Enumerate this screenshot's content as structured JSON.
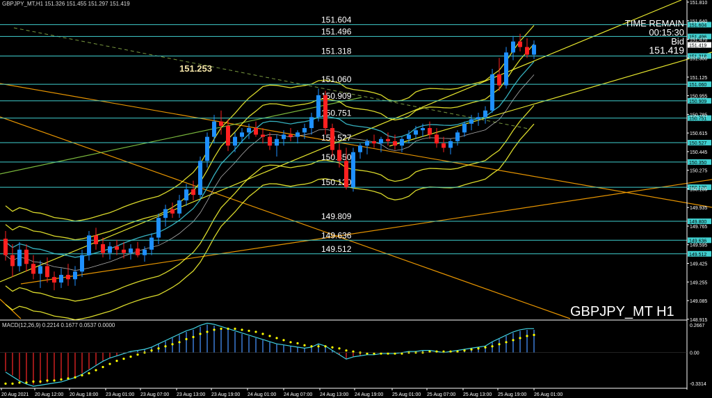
{
  "header": {
    "symbol_info": "GBPJPY_MT,H1  151.326 151.455 151.297 151.419"
  },
  "info_panel": {
    "time_remain_label": "TIME REMAIN",
    "time_remain_value": "00:15:30",
    "bid_label": "Bid",
    "bid_value": "151.419"
  },
  "symbol_label": "GBPJPY_MT H1",
  "annotation_high": "151.253",
  "macd": {
    "header": "MACD(12,26,9) 0.2214 0.1677 0.0537 0.0000",
    "axis_labels": [
      "0.2667",
      "0.00",
      "-0.3314"
    ]
  },
  "colors": {
    "background": "#000000",
    "bull_candle": "#1e90ff",
    "bear_candle": "#ff2020",
    "level_line": "#40d0d0",
    "band": "#ffff33",
    "trend_orange": "#ffa500",
    "macd_line": "#40d0e0",
    "macd_signal": "#ffff00"
  },
  "chart_data": {
    "type": "candlestick",
    "ylim": [
      148.92,
      151.81
    ],
    "y_ticks": [
      "151.810",
      "151.640",
      "151.470",
      "151.300",
      "151.125",
      "150.955",
      "150.785",
      "150.615",
      "150.445",
      "150.275",
      "150.105",
      "149.935",
      "149.765",
      "149.595",
      "149.425",
      "149.255",
      "149.085",
      "148.915"
    ],
    "x_ticks": [
      "20 Aug 2021",
      "20 Aug 12:00",
      "20 Aug 18:00",
      "23 Aug 01:00",
      "23 Aug 07:00",
      "23 Aug 13:00",
      "23 Aug 19:00",
      "24 Aug 01:00",
      "24 Aug 07:00",
      "24 Aug 13:00",
      "24 Aug 19:00",
      "25 Aug 01:00",
      "25 Aug 07:00",
      "25 Aug 13:00",
      "25 Aug 19:00",
      "26 Aug 01:00"
    ],
    "levels": [
      {
        "value": 151.604,
        "label": "151.604",
        "tag": "151.604"
      },
      {
        "value": 151.496,
        "label": "151.496",
        "tag": "151.496"
      },
      {
        "value": 151.318,
        "label": "151.318",
        "tag": "151.318"
      },
      {
        "value": 151.06,
        "label": "151.060",
        "tag": "151.060"
      },
      {
        "value": 150.909,
        "label": "150.909",
        "tag": "150.909"
      },
      {
        "value": 150.751,
        "label": "150.751",
        "tag": "150.751"
      },
      {
        "value": 150.527,
        "label": "150.527",
        "tag": "150.527"
      },
      {
        "value": 150.35,
        "label": "150.350",
        "tag": "150.350"
      },
      {
        "value": 150.12,
        "label": "150.120",
        "tag": "150.120"
      },
      {
        "value": 149.809,
        "label": "149.809",
        "tag": "149.800"
      },
      {
        "value": 149.636,
        "label": "149.636",
        "tag": "149.636"
      },
      {
        "value": 149.512,
        "label": "149.512",
        "tag": "149.512"
      }
    ],
    "current_price": {
      "value": 151.419,
      "tag": "151.419"
    },
    "candles": [
      [
        149.65,
        149.72,
        149.45,
        149.5
      ],
      [
        149.5,
        149.6,
        149.3,
        149.4
      ],
      [
        149.4,
        149.62,
        149.35,
        149.55
      ],
      [
        149.55,
        149.6,
        149.35,
        149.42
      ],
      [
        149.42,
        149.5,
        149.28,
        149.33
      ],
      [
        149.33,
        149.45,
        149.2,
        149.4
      ],
      [
        149.4,
        149.48,
        149.25,
        149.3
      ],
      [
        149.3,
        149.35,
        149.18,
        149.25
      ],
      [
        149.25,
        149.38,
        149.2,
        149.32
      ],
      [
        149.32,
        149.42,
        149.22,
        149.28
      ],
      [
        149.28,
        149.4,
        149.22,
        149.35
      ],
      [
        149.35,
        149.55,
        149.3,
        149.5
      ],
      [
        149.5,
        149.72,
        149.45,
        149.68
      ],
      [
        149.68,
        149.75,
        149.55,
        149.6
      ],
      [
        149.6,
        149.66,
        149.48,
        149.52
      ],
      [
        149.52,
        149.62,
        149.46,
        149.58
      ],
      [
        149.58,
        149.64,
        149.5,
        149.55
      ],
      [
        149.55,
        149.62,
        149.47,
        149.52
      ],
      [
        149.52,
        149.6,
        149.46,
        149.56
      ],
      [
        149.56,
        149.62,
        149.48,
        149.5
      ],
      [
        149.5,
        149.58,
        149.44,
        149.55
      ],
      [
        149.55,
        149.7,
        149.5,
        149.66
      ],
      [
        149.66,
        149.88,
        149.6,
        149.84
      ],
      [
        149.84,
        149.96,
        149.76,
        149.92
      ],
      [
        149.92,
        149.98,
        149.84,
        149.88
      ],
      [
        149.88,
        150.05,
        149.84,
        150.0
      ],
      [
        150.0,
        150.15,
        149.95,
        150.1
      ],
      [
        150.1,
        150.18,
        150.0,
        150.05
      ],
      [
        150.05,
        150.4,
        150.02,
        150.36
      ],
      [
        150.36,
        150.62,
        150.3,
        150.58
      ],
      [
        150.58,
        150.78,
        150.52,
        150.72
      ],
      [
        150.72,
        150.82,
        150.6,
        150.68
      ],
      [
        150.68,
        150.74,
        150.45,
        150.5
      ],
      [
        150.5,
        150.62,
        150.44,
        150.58
      ],
      [
        150.58,
        150.66,
        150.52,
        150.62
      ],
      [
        150.62,
        150.7,
        150.56,
        150.66
      ],
      [
        150.66,
        150.72,
        150.58,
        150.6
      ],
      [
        150.6,
        150.66,
        150.52,
        150.58
      ],
      [
        150.58,
        150.62,
        150.46,
        150.5
      ],
      [
        150.5,
        150.6,
        150.4,
        150.56
      ],
      [
        150.56,
        150.64,
        150.5,
        150.6
      ],
      [
        150.6,
        150.66,
        150.54,
        150.58
      ],
      [
        150.58,
        150.64,
        150.52,
        150.62
      ],
      [
        150.62,
        150.7,
        150.56,
        150.66
      ],
      [
        150.66,
        150.8,
        150.6,
        150.76
      ],
      [
        150.76,
        151.02,
        150.72,
        150.96
      ],
      [
        150.96,
        151.0,
        150.6,
        150.66
      ],
      [
        150.66,
        150.7,
        150.4,
        150.46
      ],
      [
        150.46,
        150.52,
        150.3,
        150.36
      ],
      [
        150.36,
        150.48,
        150.1,
        150.12
      ],
      [
        150.12,
        150.48,
        150.08,
        150.44
      ],
      [
        150.44,
        150.52,
        150.38,
        150.5
      ],
      [
        150.5,
        150.56,
        150.42,
        150.54
      ],
      [
        150.54,
        150.6,
        150.48,
        150.52
      ],
      [
        150.52,
        150.58,
        150.44,
        150.56
      ],
      [
        150.56,
        150.62,
        150.5,
        150.54
      ],
      [
        150.54,
        150.6,
        150.46,
        150.5
      ],
      [
        150.5,
        150.58,
        150.44,
        150.56
      ],
      [
        150.56,
        150.64,
        150.52,
        150.6
      ],
      [
        150.6,
        150.68,
        150.56,
        150.64
      ],
      [
        150.64,
        150.7,
        150.58,
        150.66
      ],
      [
        150.66,
        150.72,
        150.56,
        150.6
      ],
      [
        150.6,
        150.66,
        150.48,
        150.52
      ],
      [
        150.52,
        150.58,
        150.44,
        150.48
      ],
      [
        150.48,
        150.56,
        150.42,
        150.54
      ],
      [
        150.54,
        150.64,
        150.5,
        150.62
      ],
      [
        150.62,
        150.72,
        150.58,
        150.7
      ],
      [
        150.7,
        150.78,
        150.64,
        150.74
      ],
      [
        150.74,
        150.8,
        150.68,
        150.76
      ],
      [
        150.76,
        150.86,
        150.7,
        150.82
      ],
      [
        150.82,
        151.2,
        150.8,
        151.15
      ],
      [
        151.15,
        151.3,
        151.0,
        151.05
      ],
      [
        151.05,
        151.4,
        151.02,
        151.35
      ],
      [
        151.35,
        151.5,
        151.28,
        151.45
      ],
      [
        151.45,
        151.52,
        151.36,
        151.4
      ],
      [
        151.4,
        151.48,
        151.3,
        151.33
      ],
      [
        151.33,
        151.46,
        151.29,
        151.42
      ]
    ],
    "macd_hist": [
      -0.18,
      -0.22,
      -0.26,
      -0.29,
      -0.31,
      -0.3,
      -0.29,
      -0.28,
      -0.27,
      -0.25,
      -0.23,
      -0.2,
      -0.16,
      -0.12,
      -0.08,
      -0.05,
      -0.03,
      -0.01,
      0.01,
      0.02,
      0.03,
      0.05,
      0.08,
      0.11,
      0.14,
      0.17,
      0.2,
      0.22,
      0.25,
      0.27,
      0.26,
      0.24,
      0.22,
      0.2,
      0.18,
      0.16,
      0.14,
      0.12,
      0.1,
      0.08,
      0.07,
      0.06,
      0.05,
      0.04,
      0.05,
      0.08,
      0.06,
      0.02,
      -0.02,
      -0.06,
      -0.04,
      -0.03,
      -0.02,
      -0.02,
      -0.01,
      -0.01,
      -0.01,
      0.0,
      0.01,
      0.01,
      0.02,
      0.02,
      0.01,
      0.0,
      0.01,
      0.02,
      0.03,
      0.04,
      0.05,
      0.06,
      0.1,
      0.13,
      0.16,
      0.19,
      0.21,
      0.22,
      0.22
    ],
    "macd_signal": [
      -0.3,
      -0.3,
      -0.29,
      -0.29,
      -0.28,
      -0.28,
      -0.27,
      -0.27,
      -0.26,
      -0.25,
      -0.24,
      -0.22,
      -0.2,
      -0.17,
      -0.14,
      -0.11,
      -0.08,
      -0.06,
      -0.04,
      -0.02,
      0.0,
      0.02,
      0.04,
      0.06,
      0.08,
      0.1,
      0.13,
      0.15,
      0.18,
      0.2,
      0.22,
      0.23,
      0.23,
      0.23,
      0.22,
      0.21,
      0.2,
      0.18,
      0.16,
      0.14,
      0.12,
      0.1,
      0.09,
      0.07,
      0.06,
      0.06,
      0.06,
      0.05,
      0.04,
      0.02,
      0.01,
      0.0,
      -0.01,
      -0.01,
      -0.01,
      -0.01,
      -0.01,
      -0.01,
      0.0,
      0.0,
      0.0,
      0.01,
      0.01,
      0.01,
      0.01,
      0.01,
      0.02,
      0.03,
      0.04,
      0.05,
      0.06,
      0.08,
      0.1,
      0.12,
      0.14,
      0.16,
      0.17
    ],
    "macd_range": [
      -0.3314,
      0.2667
    ]
  }
}
